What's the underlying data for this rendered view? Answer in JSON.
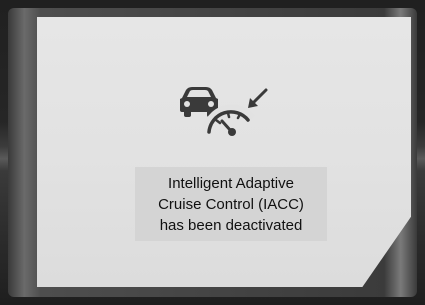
{
  "display": {
    "message_lines": [
      "Intelligent Adaptive",
      "Cruise Control (IACC)",
      "has been deactivated"
    ],
    "icon": "iacc-speedometer-car-icon"
  },
  "colors": {
    "display_background": "#e2e2e2",
    "message_box": "#d4d4d4",
    "icon": "#3a3a3a",
    "text": "#111111",
    "bezel": "#262626"
  }
}
